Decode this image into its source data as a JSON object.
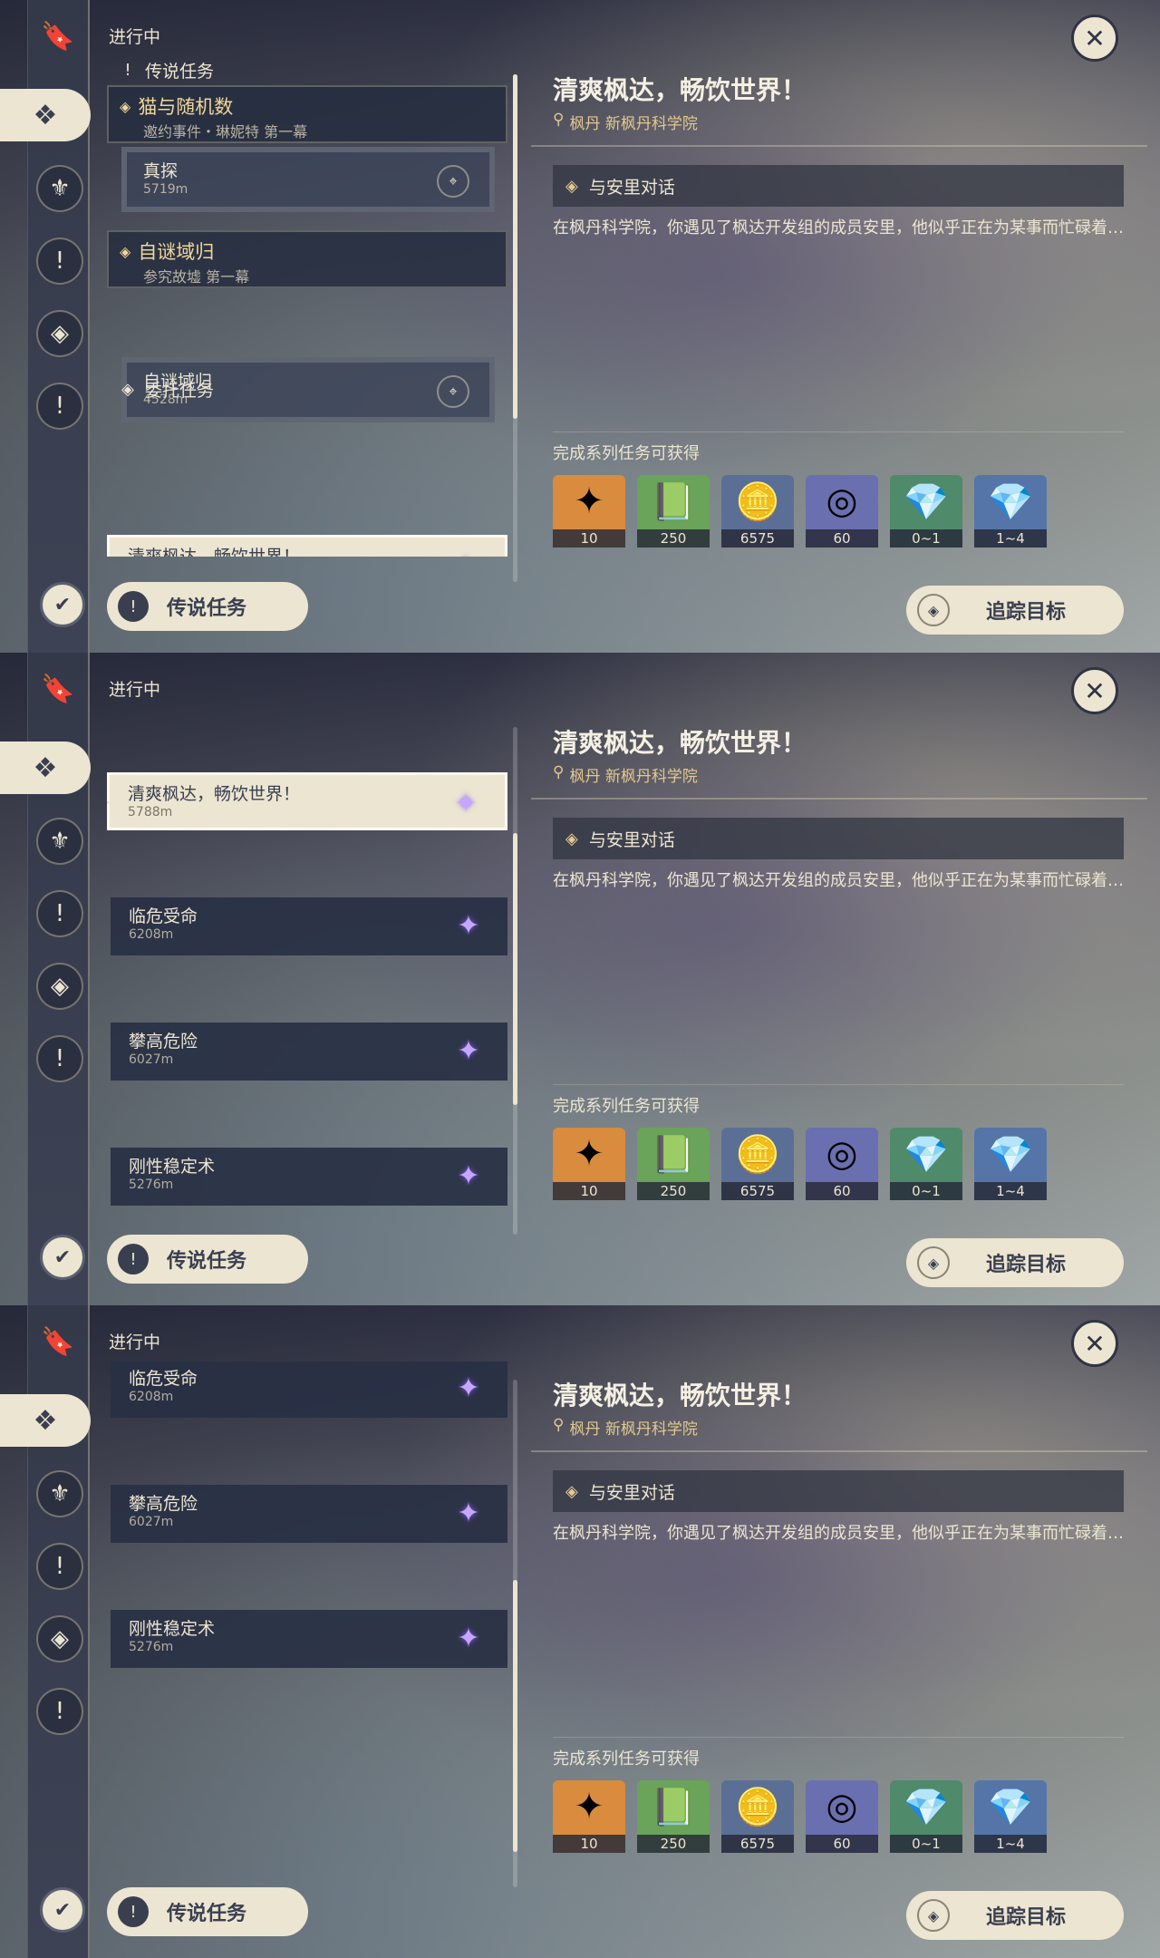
{
  "status_label": "进行中",
  "sections": {
    "legend": "传说任务",
    "commission": "委托任务"
  },
  "legend_quests": [
    {
      "title": "猫与随机数",
      "subtitle": "邀约事件・琳妮特 第一幕",
      "step": "真探",
      "distance": "5719m"
    },
    {
      "title": "自谜域归",
      "subtitle": "参究故墟 第一幕",
      "step": "自谜域归",
      "distance": "4528m"
    }
  ],
  "commissions": [
    {
      "title": "清爽枫达，畅饮世界！",
      "distance": "5788m"
    },
    {
      "title": "临危受命",
      "distance": "6208m"
    },
    {
      "title": "攀高危险",
      "distance": "6027m"
    },
    {
      "title": "刚性稳定术",
      "distance": "5276m"
    }
  ],
  "detail": {
    "title": "清爽枫达，畅饮世界！",
    "location": "枫丹 新枫丹科学院",
    "objective": "与安里对话",
    "description": "在枫丹科学院，你遇见了枫达开发组的成员安里，他似乎正在为某事而忙碌着…",
    "reward_label": "完成系列任务可获得",
    "rewards": [
      {
        "icon": "primogem-icon",
        "count": "10",
        "color": "#d98b3e"
      },
      {
        "icon": "adventure-exp-icon",
        "count": "250",
        "color": "#6aa35a"
      },
      {
        "icon": "mora-icon",
        "count": "6575",
        "color": "#5b6f96"
      },
      {
        "icon": "companionship-exp-icon",
        "count": "60",
        "color": "#6a6fb0"
      },
      {
        "icon": "crystal-small-icon",
        "count": "0~1",
        "color": "#4f8a6a"
      },
      {
        "icon": "crystal-large-icon",
        "count": "1~4",
        "color": "#5575a8"
      }
    ]
  },
  "buttons": {
    "legend_tab": "传说任务",
    "track": "追踪目标"
  },
  "scroll_progress": [
    0.0,
    0.45,
    0.85
  ]
}
